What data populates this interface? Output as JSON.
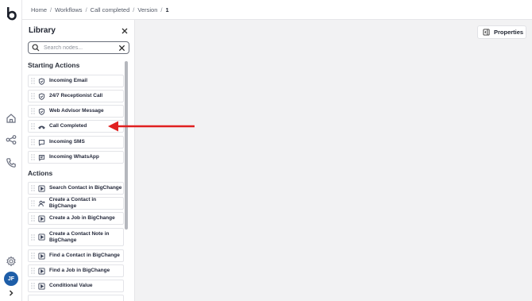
{
  "breadcrumb": {
    "items": [
      "Home",
      "Workflows",
      "Call completed",
      "Version"
    ],
    "current": "1",
    "separator": "/"
  },
  "rail": {
    "avatar_initials": "JF",
    "avatar_color": "#1e5ea8"
  },
  "library": {
    "title": "Library",
    "search_placeholder": "Search nodes...",
    "sections": [
      {
        "title": "Starting Actions",
        "items": [
          {
            "label": "Incoming Email",
            "icon": "shield-check-icon"
          },
          {
            "label": "24/7 Receptionist Call",
            "icon": "shield-check-icon"
          },
          {
            "label": "Web Advisor Message",
            "icon": "shield-check-icon"
          },
          {
            "label": "Call Completed",
            "icon": "phone-hangup-icon"
          },
          {
            "label": "Incoming SMS",
            "icon": "chat-bubble-icon"
          },
          {
            "label": "Incoming WhatsApp",
            "icon": "chat-lines-icon"
          }
        ]
      },
      {
        "title": "Actions",
        "items": [
          {
            "label": "Search Contact in BigChange",
            "icon": "play-icon"
          },
          {
            "label": "Create a Contact in BigChange",
            "icon": "user-plus-icon"
          },
          {
            "label": "Create a Job in BigChange",
            "icon": "play-icon"
          },
          {
            "label": "Create a Contact Note in BigChange",
            "icon": "play-icon"
          },
          {
            "label": "Find a Contact in BigChange",
            "icon": "play-icon"
          },
          {
            "label": "Find a Job in BigChange",
            "icon": "play-icon"
          },
          {
            "label": "Conditional Value",
            "icon": "play-icon"
          }
        ]
      }
    ]
  },
  "properties_button": {
    "label": "Properties",
    "icon": "panel-icon"
  },
  "colors": {
    "accent_arrow": "#e02020",
    "canvas_bg": "#f2f2f3",
    "avatar": "#1e5ea8"
  }
}
